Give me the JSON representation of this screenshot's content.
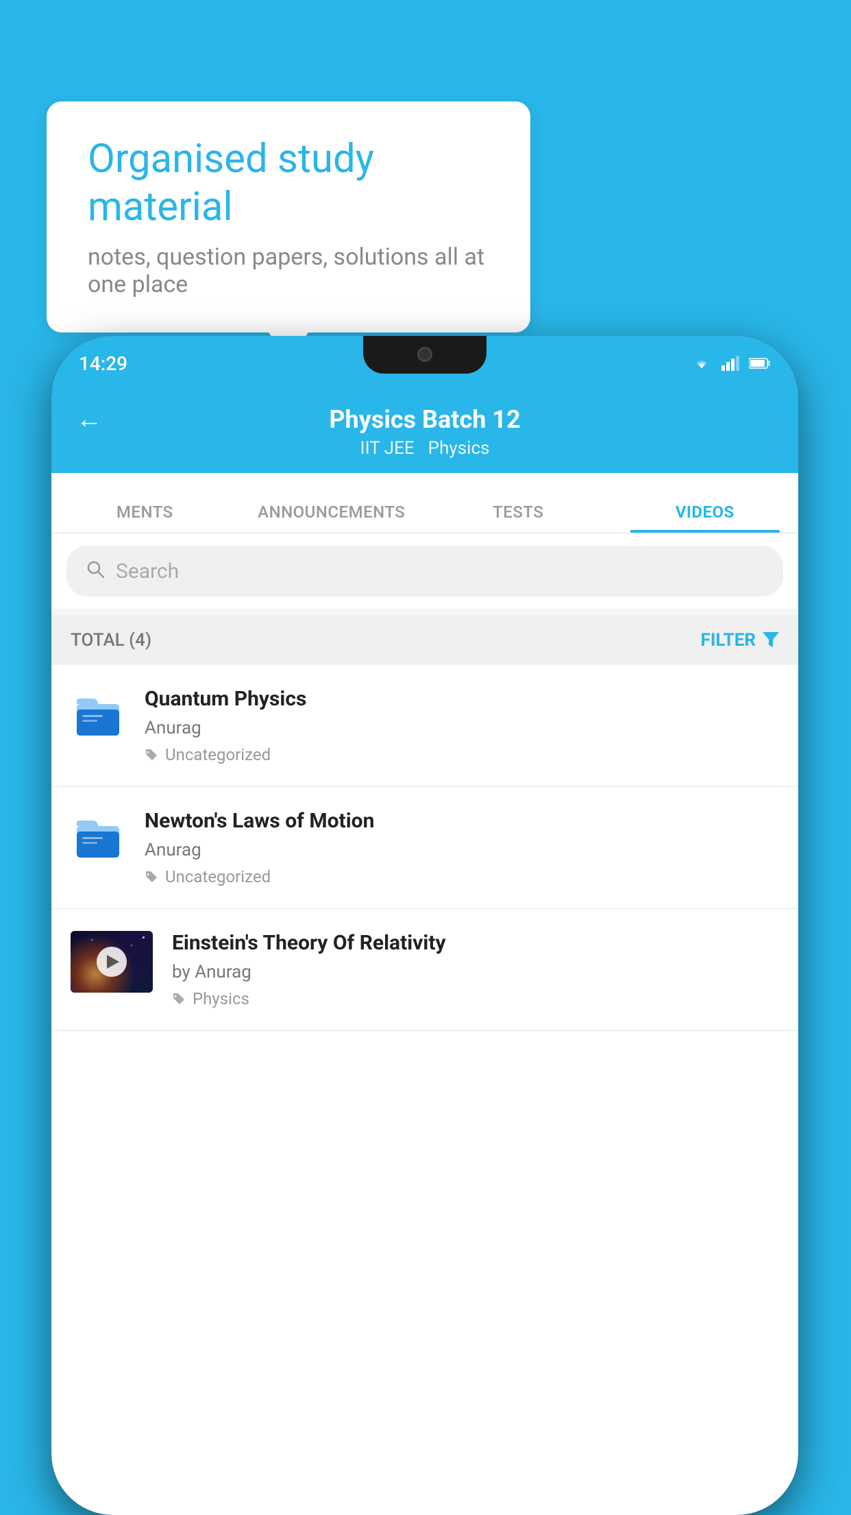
{
  "background_color": "#29B6E8",
  "bubble": {
    "title": "Organised study material",
    "subtitle": "notes, question papers, solutions all at one place"
  },
  "phone": {
    "time": "14:29",
    "header": {
      "title": "Physics Batch 12",
      "subtitle_left": "IIT JEE",
      "subtitle_right": "Physics",
      "back_label": "←"
    },
    "tabs": [
      {
        "label": "MENTS",
        "active": false
      },
      {
        "label": "ANNOUNCEMENTS",
        "active": false
      },
      {
        "label": "TESTS",
        "active": false
      },
      {
        "label": "VIDEOS",
        "active": true
      }
    ],
    "search": {
      "placeholder": "Search"
    },
    "filter": {
      "total_label": "TOTAL (4)",
      "filter_label": "FILTER"
    },
    "videos": [
      {
        "title": "Quantum Physics",
        "author": "Anurag",
        "tag": "Uncategorized",
        "type": "folder"
      },
      {
        "title": "Newton's Laws of Motion",
        "author": "Anurag",
        "tag": "Uncategorized",
        "type": "folder"
      },
      {
        "title": "Einstein's Theory Of Relativity",
        "author": "by Anurag",
        "tag": "Physics",
        "type": "video"
      }
    ]
  }
}
